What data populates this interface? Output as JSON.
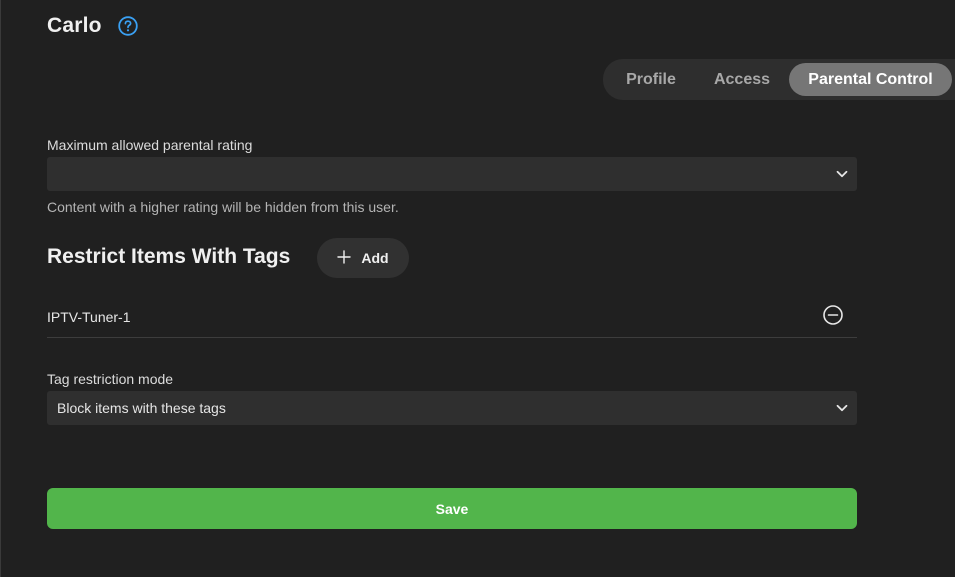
{
  "header": {
    "user_name": "Carlo",
    "help_icon": "question-circle-icon"
  },
  "tabs": [
    {
      "label": "Profile",
      "active": false
    },
    {
      "label": "Access",
      "active": false
    },
    {
      "label": "Parental Control",
      "active": true
    }
  ],
  "parental_rating": {
    "label": "Maximum allowed parental rating",
    "value": "",
    "helper": "Content with a higher rating will be hidden from this user."
  },
  "restrict_tags": {
    "title": "Restrict Items With Tags",
    "add_label": "Add",
    "add_icon": "plus-icon",
    "items": [
      {
        "name": "IPTV-Tuner-1",
        "remove_icon": "minus-circle-icon"
      }
    ]
  },
  "tag_mode": {
    "label": "Tag restriction mode",
    "value": "Block items with these tags"
  },
  "save_label": "Save",
  "colors": {
    "background": "#202020",
    "accent_green": "#52b54b",
    "help_blue": "#3aa0f3",
    "active_tab": "#767676"
  }
}
